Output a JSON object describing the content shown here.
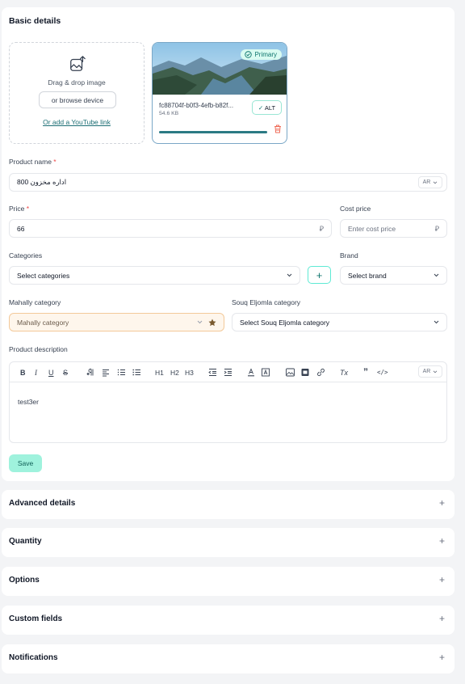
{
  "basic_details": {
    "title": "Basic details",
    "dropzone": {
      "drag_text": "Drag & drop image",
      "browse_label": "or browse device",
      "youtube_link": "Or add a YouTube link"
    },
    "image": {
      "badge": "Primary",
      "filename": "fc88704f-b0f3-4efb-b82f...",
      "size": "54.6 KB",
      "alt_label": "ALT",
      "upload_progress": 1.0
    },
    "product_name": {
      "label": "Product name",
      "required": "*",
      "value": "اداره مخزون 800",
      "lang": "AR"
    },
    "price": {
      "label": "Price",
      "required": "*",
      "value": "66",
      "currency": "⃁"
    },
    "cost_price": {
      "label": "Cost price",
      "placeholder": "Enter cost price",
      "currency": "⃁"
    },
    "categories": {
      "label": "Categories",
      "value": "Select categories",
      "add": "+"
    },
    "brand": {
      "label": "Brand",
      "value": "Select brand"
    },
    "mahally": {
      "label": "Mahally category",
      "value": "Mahally category"
    },
    "souq": {
      "label": "Souq Eljomla category",
      "value": "Select Souq Eljomla category"
    },
    "description": {
      "label": "Product description",
      "lang": "AR",
      "content": "test3er",
      "toolbar": {
        "bold": "B",
        "italic": "I",
        "underline": "U",
        "strike": "S",
        "h1": "H1",
        "h2": "H2",
        "h3": "H3",
        "quote": "”",
        "code": "</>",
        "clear": "Tx"
      }
    },
    "save_label": "Save"
  },
  "sections": [
    {
      "title": "Advanced details",
      "icon": "+"
    },
    {
      "title": "Quantity",
      "icon": "+"
    },
    {
      "title": "Options",
      "icon": "+"
    },
    {
      "title": "Custom fields",
      "icon": "+"
    },
    {
      "title": "Notifications",
      "icon": "+"
    }
  ],
  "colors": {
    "accent": "#0f766e",
    "save_bg": "#9ff2dd",
    "mahally_bg": "#fef6ec"
  }
}
